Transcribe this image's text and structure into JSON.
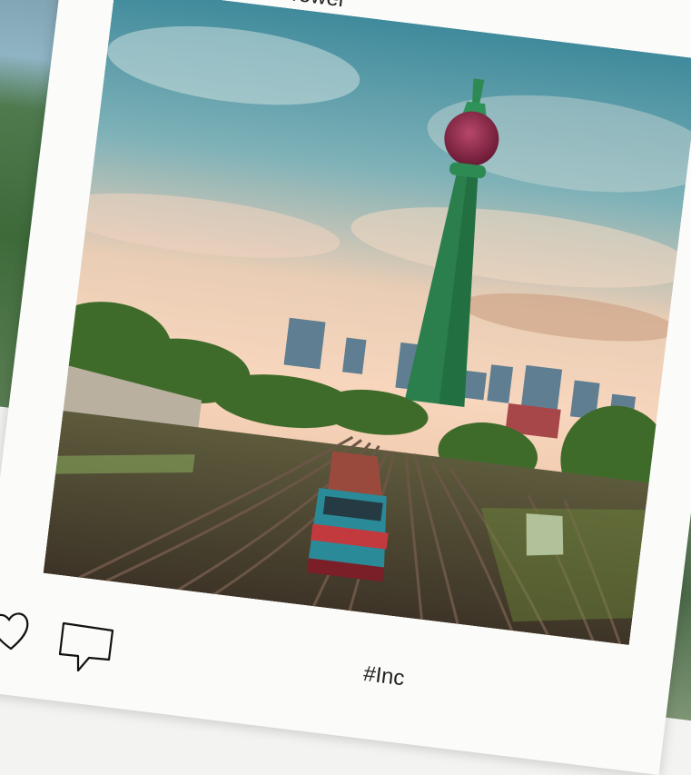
{
  "card": {
    "title": "Tower",
    "caption": "#Inc"
  },
  "actions": [
    {
      "icon": "heart-icon"
    },
    {
      "icon": "comment-icon"
    }
  ],
  "background": {
    "glyph": "' '"
  },
  "colors": {
    "frame": "#fbfbfa",
    "sky_top": "#4f92a3",
    "sky_sunset": "#f5c7ad",
    "tower_shaft": "#2c8a52",
    "tower_pod": "#8a2545",
    "train_body": "#2b8a98",
    "train_band": "#c33a3e",
    "rail": "#6b5646",
    "foliage": "#3f6b2a"
  }
}
